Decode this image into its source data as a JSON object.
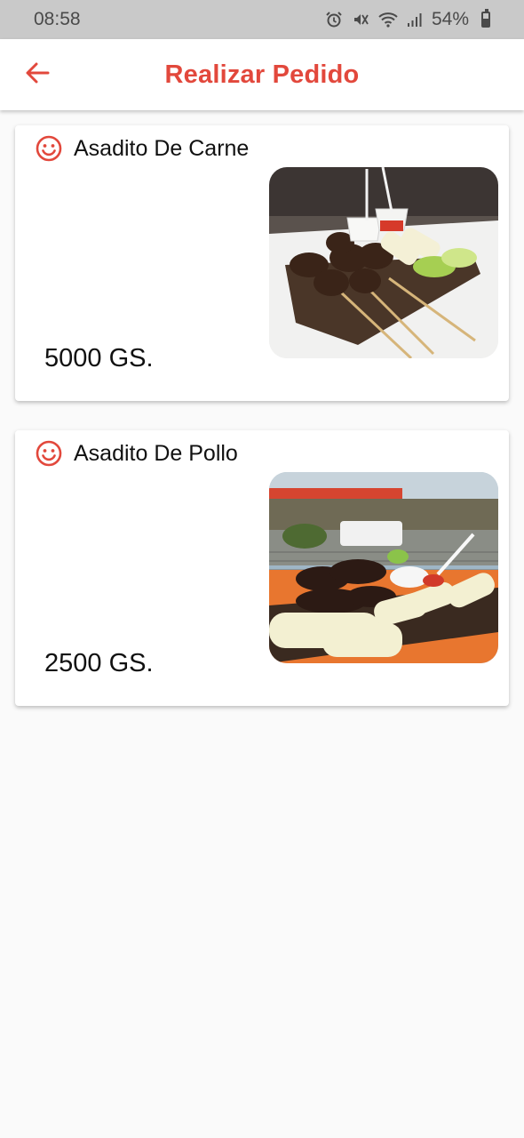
{
  "status_bar": {
    "time": "08:58",
    "battery": "54%",
    "icons": [
      "alarm-icon",
      "mute-icon",
      "wifi-icon",
      "signal-icon",
      "battery-icon"
    ]
  },
  "app_bar": {
    "title": "Realizar Pedido",
    "back_icon": "arrow-back-icon"
  },
  "colors": {
    "accent": "#e2483c",
    "status_bar_bg": "#c9c9c9",
    "page_bg": "#fafafa"
  },
  "products": [
    {
      "name": "Asadito De Carne",
      "price": "5000 GS.",
      "icon": "smile-icon",
      "image": "beef-skewers-photo"
    },
    {
      "name": "Asadito De Pollo",
      "price": "2500 GS.",
      "icon": "smile-icon",
      "image": "chicken-skewers-photo"
    }
  ]
}
